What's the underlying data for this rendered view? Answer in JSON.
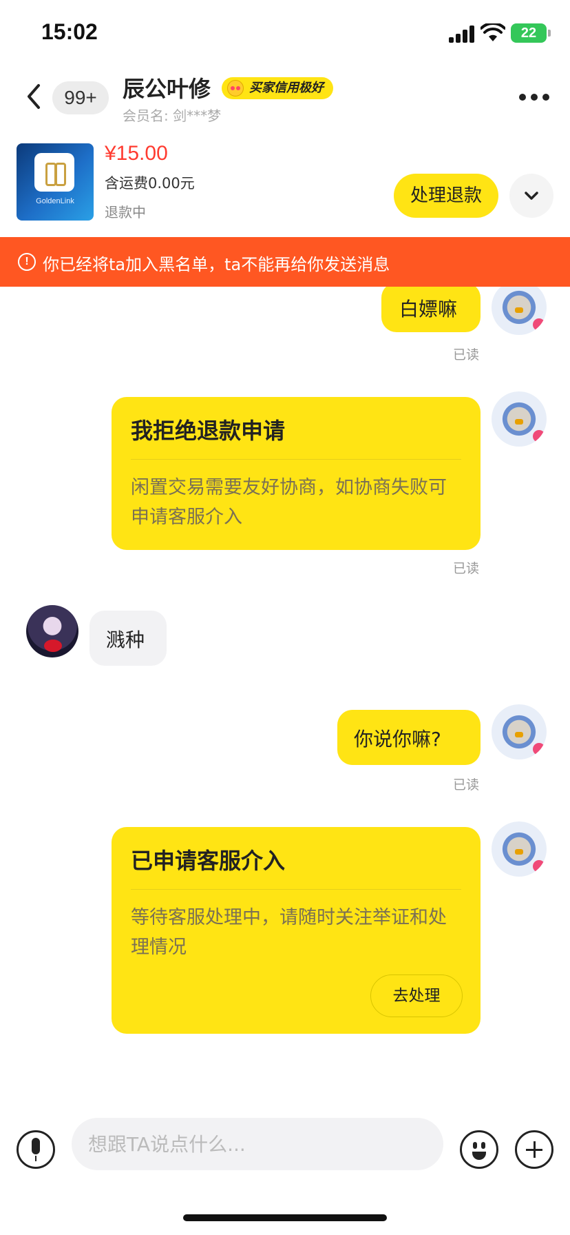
{
  "status_bar": {
    "time": "15:02",
    "battery": "22"
  },
  "header": {
    "unread_count": "99+",
    "contact_name": "辰公叶修",
    "credit_badge": "买家信用极好",
    "member_label": "会员名: 剑***梦"
  },
  "product": {
    "thumb_text": "GoldenLink",
    "price": "¥15.00",
    "shipping": "含运费0.00元",
    "status": "退款中",
    "refund_button": "处理退款"
  },
  "warning": {
    "icon": "!",
    "text": "你已经将ta加入黑名单，ta不能再给你发送消息"
  },
  "chat": {
    "read_label": "已读",
    "messages": [
      {
        "side": "right",
        "text": "白嫖嘛"
      },
      {
        "side": "right",
        "type": "card",
        "title": "我拒绝退款申请",
        "body": "闲置交易需要友好协商，如协商失败可申请客服介入"
      },
      {
        "side": "left",
        "text": "溅种"
      },
      {
        "side": "right",
        "text": "你说你嘛?"
      },
      {
        "side": "right",
        "type": "card",
        "title": "已申请客服介入",
        "body": "等待客服处理中，请随时关注举证和处理情况",
        "button": "去处理"
      }
    ]
  },
  "input": {
    "placeholder": "想跟TA说点什么..."
  },
  "colors": {
    "accent_yellow": "#ffe414",
    "warning_orange": "#ff5722",
    "price_red": "#ff3b30"
  },
  "icons": [
    "back-icon",
    "more-icon",
    "chevron-down-icon",
    "warning-icon",
    "microphone-icon",
    "emoji-icon",
    "plus-icon"
  ]
}
